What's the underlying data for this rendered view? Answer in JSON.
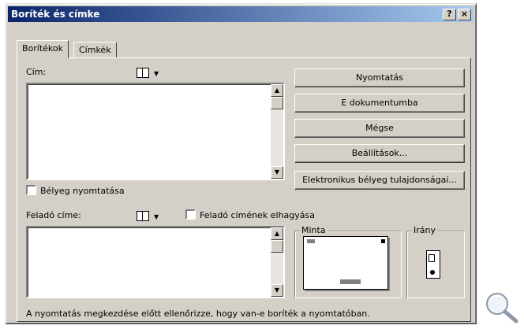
{
  "window": {
    "title": "Boríték és címke",
    "help_button": "?",
    "close_button": "×"
  },
  "tabs": [
    {
      "label": "Borítékok",
      "active": true
    },
    {
      "label": "Címkék",
      "active": false
    }
  ],
  "address": {
    "label": "Cím:",
    "value": "",
    "stamp_checkbox_label": "Bélyeg nyomtatása",
    "stamp_checked": false
  },
  "sender": {
    "label": "Feladó címe:",
    "value": "",
    "omit_checkbox_label": "Feladó címének elhagyása",
    "omit_checked": false
  },
  "buttons": {
    "print": "Nyomtatás",
    "add_to_document": "E dokumentumba",
    "cancel": "Mégse",
    "options": "Beállítások...",
    "e_postage": "Elektronikus bélyeg tulajdonságai..."
  },
  "preview": {
    "label": "Minta"
  },
  "feed": {
    "label": "Irány"
  },
  "status_text": "A nyomtatás megkezdése előtt ellenőrizze, hogy van-e boríték a nyomtatóban."
}
